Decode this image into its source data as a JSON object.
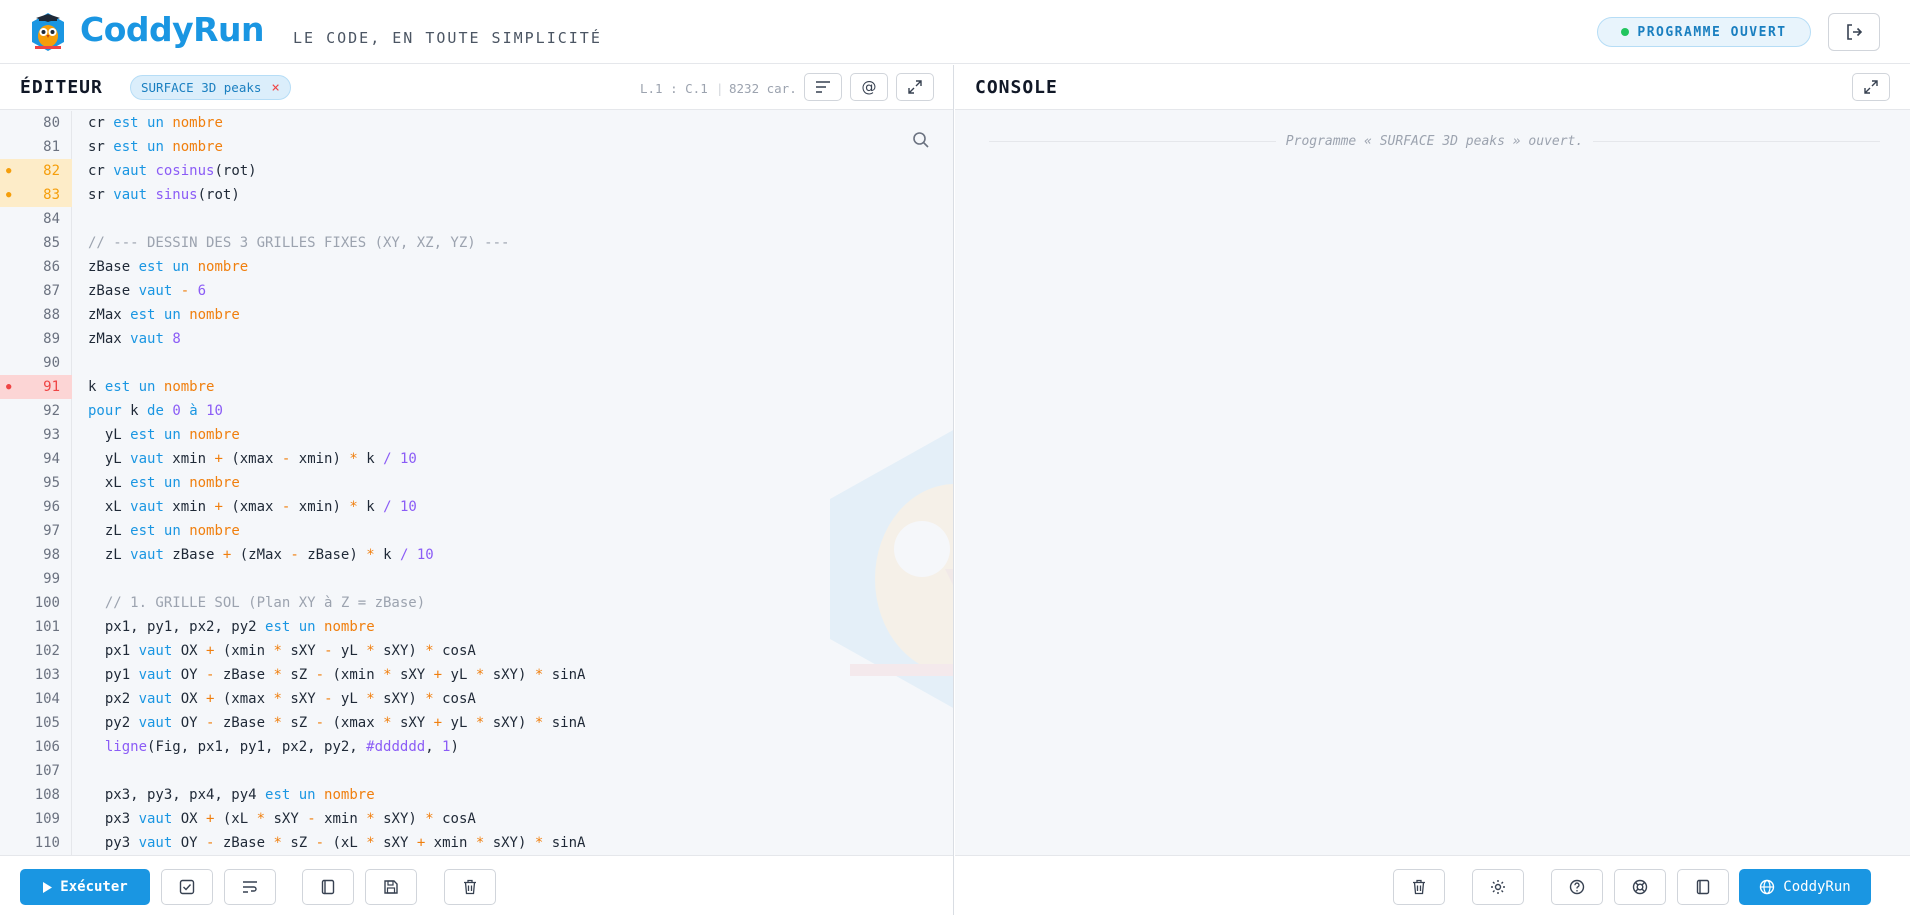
{
  "header": {
    "brand": "CoddyRun",
    "tagline": "LE CODE, EN TOUTE SIMPLICITÉ",
    "status": "PROGRAMME OUVERT"
  },
  "editor": {
    "title": "ÉDITEUR",
    "file_chip": "SURFACE 3D peaks",
    "chip_close": "×",
    "cursor": "L.1 : C.1",
    "separator": "|",
    "char_count": "8232 car.",
    "at_label": "@",
    "run_label": "Exécuter",
    "lines": [
      {
        "n": "80",
        "state": "",
        "code": "cr est un nombre"
      },
      {
        "n": "81",
        "state": "",
        "code": "sr est un nombre"
      },
      {
        "n": "82",
        "state": "warn",
        "code": "cr vaut cosinus(rot)"
      },
      {
        "n": "83",
        "state": "warn",
        "code": "sr vaut sinus(rot)"
      },
      {
        "n": "84",
        "state": "",
        "code": ""
      },
      {
        "n": "85",
        "state": "",
        "code": "// --- DESSIN DES 3 GRILLES FIXES (XY, XZ, YZ) ---"
      },
      {
        "n": "86",
        "state": "",
        "code": "zBase est un nombre"
      },
      {
        "n": "87",
        "state": "",
        "code": "zBase vaut - 6"
      },
      {
        "n": "88",
        "state": "",
        "code": "zMax est un nombre"
      },
      {
        "n": "89",
        "state": "",
        "code": "zMax vaut 8"
      },
      {
        "n": "90",
        "state": "",
        "code": ""
      },
      {
        "n": "91",
        "state": "err",
        "code": "k est un nombre"
      },
      {
        "n": "92",
        "state": "",
        "code": "pour k de 0 à 10"
      },
      {
        "n": "93",
        "state": "",
        "code": "  yL est un nombre"
      },
      {
        "n": "94",
        "state": "",
        "code": "  yL vaut xmin + (xmax - xmin) * k / 10"
      },
      {
        "n": "95",
        "state": "",
        "code": "  xL est un nombre"
      },
      {
        "n": "96",
        "state": "",
        "code": "  xL vaut xmin + (xmax - xmin) * k / 10"
      },
      {
        "n": "97",
        "state": "",
        "code": "  zL est un nombre"
      },
      {
        "n": "98",
        "state": "",
        "code": "  zL vaut zBase + (zMax - zBase) * k / 10"
      },
      {
        "n": "99",
        "state": "",
        "code": ""
      },
      {
        "n": "100",
        "state": "",
        "code": "  // 1. GRILLE SOL (Plan XY à Z = zBase)"
      },
      {
        "n": "101",
        "state": "",
        "code": "  px1, py1, px2, py2 est un nombre"
      },
      {
        "n": "102",
        "state": "",
        "code": "  px1 vaut OX + (xmin * sXY - yL * sXY) * cosA"
      },
      {
        "n": "103",
        "state": "",
        "code": "  py1 vaut OY - zBase * sZ - (xmin * sXY + yL * sXY) * sinA"
      },
      {
        "n": "104",
        "state": "",
        "code": "  px2 vaut OX + (xmax * sXY - yL * sXY) * cosA"
      },
      {
        "n": "105",
        "state": "",
        "code": "  py2 vaut OY - zBase * sZ - (xmax * sXY + yL * sXY) * sinA"
      },
      {
        "n": "106",
        "state": "",
        "code": "  ligne(Fig, px1, py1, px2, py2, #dddddd, 1)"
      },
      {
        "n": "107",
        "state": "",
        "code": ""
      },
      {
        "n": "108",
        "state": "",
        "code": "  px3, py3, px4, py4 est un nombre"
      },
      {
        "n": "109",
        "state": "",
        "code": "  px3 vaut OX + (xL * sXY - xmin * sXY) * cosA"
      },
      {
        "n": "110",
        "state": "",
        "code": "  py3 vaut OY - zBase * sZ - (xL * sXY + xmin * sXY) * sinA"
      }
    ]
  },
  "console": {
    "title": "CONSOLE",
    "hint": "Programme « SURFACE 3D peaks » ouvert.",
    "coddy_label": "CoddyRun"
  },
  "colors": {
    "accent": "#1a96e2",
    "keyword": "#1a96e2",
    "type": "#f07f0e",
    "number": "#8b5cf6",
    "warning": "#f59e0b",
    "error": "#ef4444"
  }
}
